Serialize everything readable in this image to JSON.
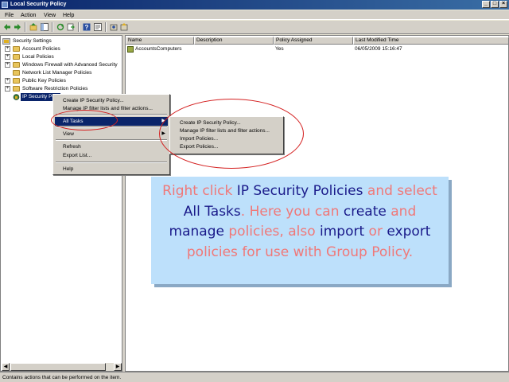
{
  "window": {
    "title": "Local Security Policy",
    "min": "_",
    "max": "□",
    "close": "×"
  },
  "menu": [
    "File",
    "Action",
    "View",
    "Help"
  ],
  "toolbar_icons": [
    "back-icon",
    "forward-icon",
    "up-icon",
    "show-tree-icon",
    "refresh-icon",
    "export-icon",
    "help-icon",
    "properties-icon",
    "assign-icon",
    "unassign-icon"
  ],
  "tree": {
    "root": "Security Settings",
    "items": [
      "Account Policies",
      "Local Policies",
      "Windows Firewall with Advanced Security",
      "Network List Manager Policies",
      "Public Key Policies",
      "Software Restriction Policies",
      "IP Security Po..."
    ]
  },
  "list": {
    "columns": [
      "Name",
      "Description",
      "Policy Assigned",
      "Last Modified Time"
    ],
    "rows": [
      {
        "name": "AccountsComputers",
        "description": "",
        "assigned": "Yes",
        "modified": "06/05/2009 15:16:47"
      }
    ]
  },
  "context_menu": {
    "items": [
      "Create IP Security Policy...",
      "Manage IP filter lists and filter actions...",
      "All Tasks",
      "View",
      "Refresh",
      "Export List...",
      "Help"
    ]
  },
  "submenu": {
    "items": [
      "Create IP Security Policy...",
      "Manage IP filter lists and filter actions...",
      "Import Policies...",
      "Export Policies..."
    ]
  },
  "status": "Contains actions that can be performed on the item.",
  "callout": {
    "p1": "Right click ",
    "p2": "IP Security Policies",
    "p3": " and select ",
    "p4": "All Tasks",
    "p5": ". Here you can ",
    "p6": "create",
    "p7": " and ",
    "p8": "manage",
    "p9": " policies, also ",
    "p10": "import",
    "p11": " or ",
    "p12": "export",
    "p13": " policies for use with Group Policy."
  },
  "colors": {
    "accent": "#0a246a",
    "callout_bg": "#bde0fb",
    "highlight_pink": "#f07878",
    "highlight_blue": "#1a1a8a",
    "annotation_red": "#d42020"
  }
}
